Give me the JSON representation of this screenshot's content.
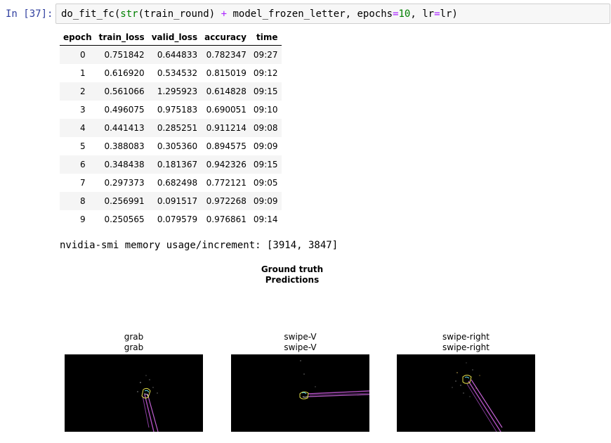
{
  "cell": {
    "prompt": "In [37]:",
    "code": {
      "fn": "do_fit_fc(",
      "builtin": "str",
      "arg1": "(train_round) ",
      "plus": "+",
      "arg2": " model_frozen_letter, epochs",
      "eq1": "=",
      "epochs": "10",
      "sep": ", lr",
      "eq2": "=",
      "tail": "lr)"
    }
  },
  "table": {
    "headers": [
      "epoch",
      "train_loss",
      "valid_loss",
      "accuracy",
      "time"
    ],
    "rows": [
      [
        "0",
        "0.751842",
        "0.644833",
        "0.782347",
        "09:27"
      ],
      [
        "1",
        "0.616920",
        "0.534532",
        "0.815019",
        "09:12"
      ],
      [
        "2",
        "0.561066",
        "1.295923",
        "0.614828",
        "09:15"
      ],
      [
        "3",
        "0.496075",
        "0.975183",
        "0.690051",
        "09:10"
      ],
      [
        "4",
        "0.441413",
        "0.285251",
        "0.911214",
        "09:08"
      ],
      [
        "5",
        "0.388083",
        "0.305360",
        "0.894575",
        "09:09"
      ],
      [
        "6",
        "0.348438",
        "0.181367",
        "0.942326",
        "09:15"
      ],
      [
        "7",
        "0.297373",
        "0.682498",
        "0.772121",
        "09:05"
      ],
      [
        "8",
        "0.256991",
        "0.091517",
        "0.972268",
        "09:09"
      ],
      [
        "9",
        "0.250565",
        "0.079579",
        "0.976861",
        "09:14"
      ]
    ]
  },
  "stdout": "nvidia-smi memory usage/increment: [3914, 3847]",
  "figure": {
    "title_line1": "Ground truth",
    "title_line2": "Predictions",
    "panels": [
      {
        "truth": "grab",
        "prediction": "grab"
      },
      {
        "truth": "swipe-V",
        "prediction": "swipe-V"
      },
      {
        "truth": "swipe-right",
        "prediction": "swipe-right"
      }
    ]
  },
  "colors": {
    "prompt": "#303f9f",
    "builtin": "#008000",
    "operator": "#aa22ff",
    "stripe": "#f5f5f5",
    "cell_bg": "#f7f7f7"
  }
}
